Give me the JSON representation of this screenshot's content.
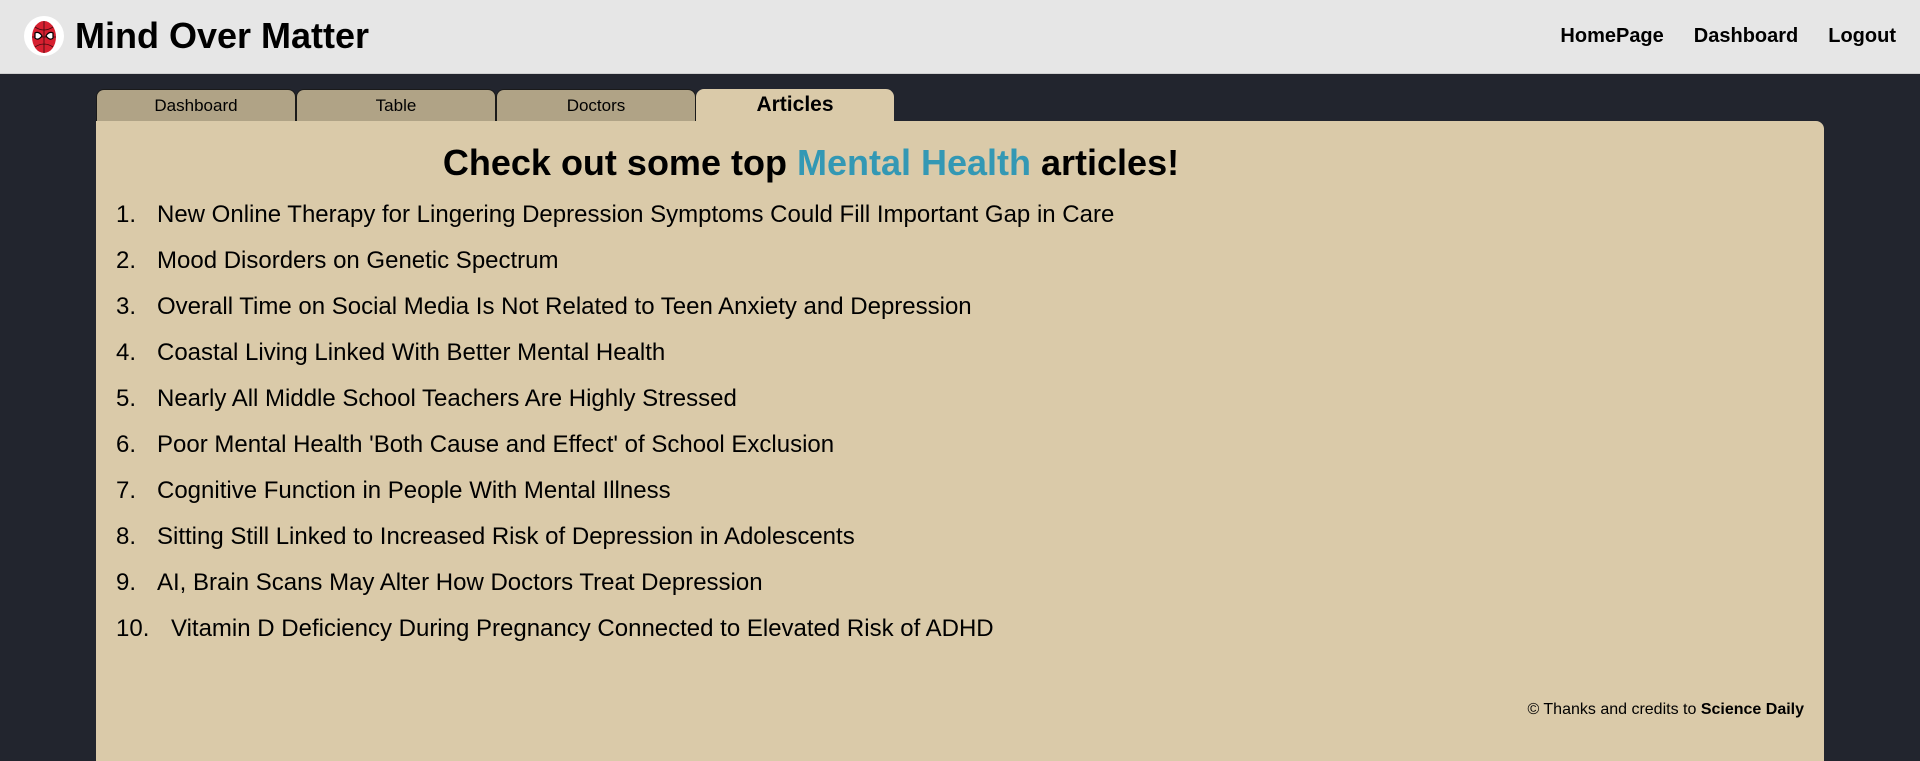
{
  "app": {
    "brand": "Mind Over Matter",
    "logo_icon": "spider-mask-icon",
    "accent_color": "#3398b4"
  },
  "nav": {
    "links": [
      "HomePage",
      "Dashboard",
      "Logout"
    ]
  },
  "tabs": [
    {
      "label": "Dashboard",
      "active": false
    },
    {
      "label": "Table",
      "active": false
    },
    {
      "label": "Doctors",
      "active": false
    },
    {
      "label": "Articles",
      "active": true
    }
  ],
  "main": {
    "heading_prefix": "Check out some top",
    "heading_highlight": "Mental Health",
    "heading_suffix": "articles!",
    "articles": [
      {
        "num": "1.",
        "title": "New Online Therapy for Lingering Depression Symptoms Could Fill Important Gap in Care"
      },
      {
        "num": "2.",
        "title": "Mood Disorders on Genetic Spectrum"
      },
      {
        "num": "3.",
        "title": "Overall Time on Social Media Is Not Related to Teen Anxiety and Depression"
      },
      {
        "num": "4.",
        "title": "Coastal Living Linked With Better Mental Health"
      },
      {
        "num": "5.",
        "title": "Nearly All Middle School Teachers Are Highly Stressed"
      },
      {
        "num": "6.",
        "title": "Poor Mental Health 'Both Cause and Effect' of School Exclusion"
      },
      {
        "num": "7.",
        "title": "Cognitive Function in People With Mental Illness"
      },
      {
        "num": "8.",
        "title": "Sitting Still Linked to Increased Risk of Depression in Adolescents"
      },
      {
        "num": "9.",
        "title": "AI, Brain Scans May Alter How Doctors Treat Depression"
      },
      {
        "num": "10.",
        "title": "Vitamin D Deficiency During Pregnancy Connected to Elevated Risk of ADHD"
      }
    ],
    "credits_prefix": "© Thanks and credits to",
    "credits_source": "Science Daily"
  }
}
